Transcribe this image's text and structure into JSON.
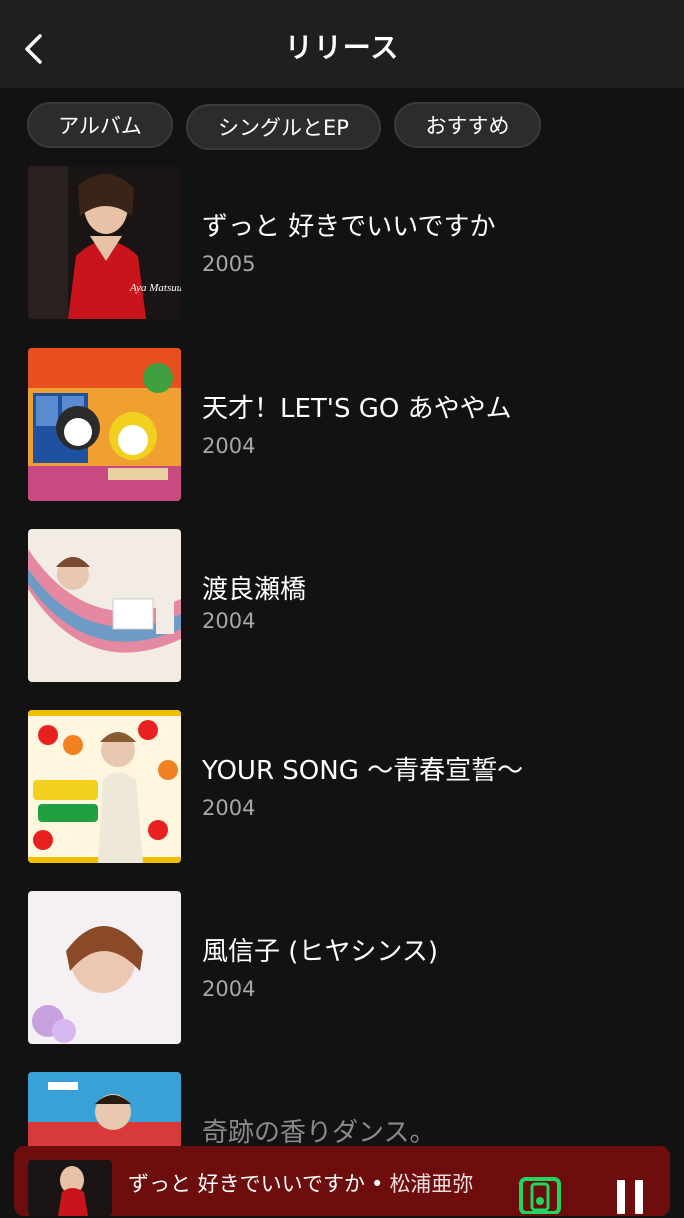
{
  "header": {
    "title": "リリース",
    "back_icon": "chevron-left-icon"
  },
  "filters": {
    "albums": "アルバム",
    "singles_ep": "シングルとEP",
    "featured": "おすすめ"
  },
  "releases": [
    {
      "title": "ずっと 好きでいいですか",
      "year": "2005",
      "cover_text": "Aya Matsuura"
    },
    {
      "title": "天才！LET'S GO あややム",
      "year": "2004"
    },
    {
      "title": "渡良瀬橋",
      "year": "2004"
    },
    {
      "title": "YOUR SONG ～青春宣誓～",
      "year": "2004"
    },
    {
      "title": "風信子 (ヒヤシンス)",
      "year": "2004"
    },
    {
      "title": "奇跡の香りダンス。",
      "year": ""
    }
  ],
  "player": {
    "track": "ずっと 好きでいいですか",
    "separator": "•",
    "artist": "松浦亜弥",
    "device_icon": "speaker-device-icon",
    "pause_icon": "pause-icon",
    "background": "#6e0d0d",
    "accent": "#1ed760"
  }
}
